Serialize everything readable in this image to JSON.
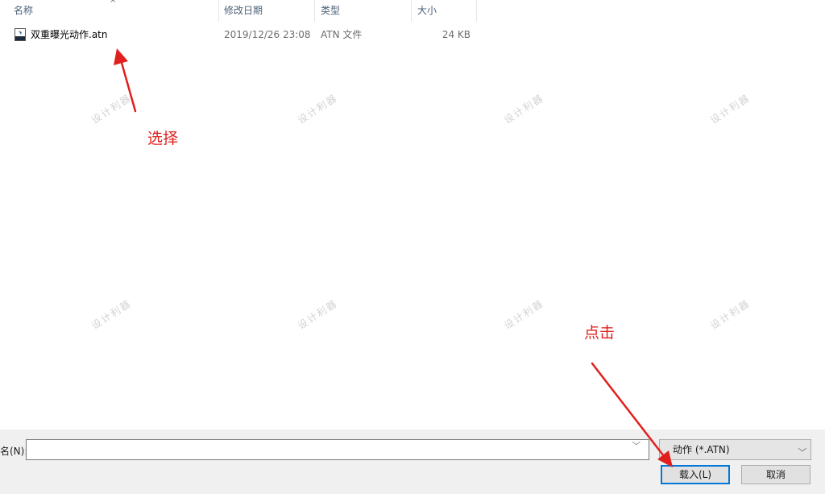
{
  "columns": [
    {
      "label": "名称"
    },
    {
      "label": "修改日期"
    },
    {
      "label": "类型"
    },
    {
      "label": "大小"
    }
  ],
  "files": [
    {
      "name": "双重曝光动作.atn",
      "modified": "2019/12/26 23:08",
      "type": "ATN 文件",
      "size": "24 KB"
    }
  ],
  "watermark": "设计利器",
  "annotations": {
    "select": "选择",
    "click": "点击",
    "color": "#e0201e"
  },
  "footer": {
    "filename_label": "名(N):",
    "filename_value": "",
    "filter_value": "动作 (*.ATN)",
    "load_button": "载入(L)",
    "cancel_button": "取消"
  }
}
